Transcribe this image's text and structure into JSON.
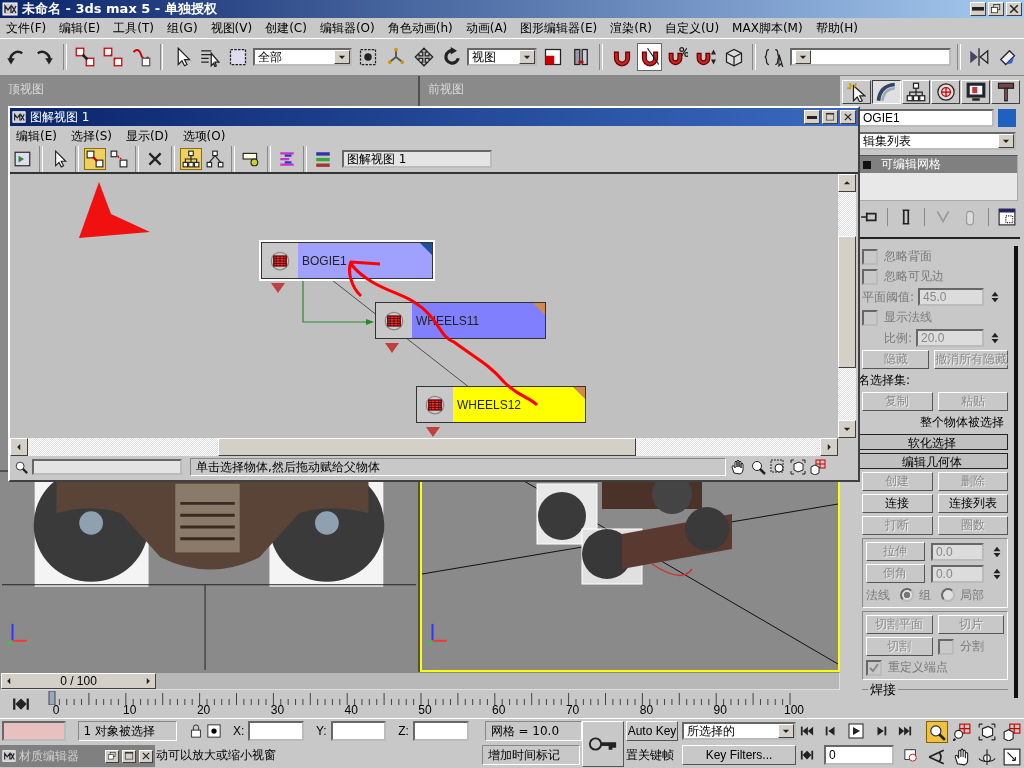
{
  "window": {
    "title": "未命名 - 3ds max 5 - 单独授权"
  },
  "menu": [
    "文件(F)",
    "编辑(E)",
    "工具(T)",
    "组(G)",
    "视图(V)",
    "创建(C)",
    "编辑器(O)",
    "角色动画(h)",
    "动画(A)",
    "图形编辑器(E)",
    "渲染(R)",
    "自定义(U)",
    "MAX脚本(M)",
    "帮助(H)"
  ],
  "toolbar": {
    "selection_filter": "全部",
    "coordinate_system": "视图",
    "buttons": [
      {
        "kind": "undo",
        "on": false
      },
      {
        "kind": "redo",
        "on": false
      },
      {
        "kind": "link",
        "on": false
      },
      {
        "kind": "unlink",
        "on": false
      },
      {
        "kind": "bind",
        "on": false
      },
      {
        "kind": "pointer",
        "on": false
      },
      {
        "kind": "select-name",
        "on": false
      },
      {
        "kind": "region",
        "on": false
      },
      {
        "kind": "crossing",
        "on": false
      },
      {
        "kind": "manipulate",
        "on": false
      },
      {
        "kind": "move",
        "on": false
      },
      {
        "kind": "rotate",
        "on": false
      },
      {
        "kind": "scale",
        "on": false
      },
      {
        "kind": "pivot",
        "on": false
      },
      {
        "kind": "snap",
        "on": false
      },
      {
        "kind": "angle-snap",
        "on": true
      },
      {
        "kind": "percent-snap",
        "on": false
      },
      {
        "kind": "spinner-snap",
        "on": false
      },
      {
        "kind": "sets",
        "on": false
      },
      {
        "kind": "named-sets",
        "on": false
      },
      {
        "kind": "mirror",
        "on": false
      },
      {
        "kind": "align",
        "on": false
      }
    ]
  },
  "viewports": [
    {
      "label": "顶视图",
      "active": false
    },
    {
      "label": "前视图",
      "active": false
    },
    {
      "active": false
    },
    {
      "active": true
    }
  ],
  "schematic": {
    "title": "图解视图 1",
    "menu": [
      "编辑(E)",
      "选择(S)",
      "显示(D)",
      "选项(O)"
    ],
    "toolbar": [
      {
        "kind": "floater",
        "selected": false
      },
      {
        "kind": "pointer",
        "selected": false
      },
      {
        "kind": "connect",
        "selected": true
      },
      {
        "kind": "disconnect",
        "selected": false
      },
      {
        "kind": "delete",
        "selected": false
      },
      {
        "kind": "hierarchy",
        "selected": true
      },
      {
        "kind": "references",
        "selected": false
      },
      {
        "kind": "filter",
        "selected": false
      },
      {
        "kind": "arrange",
        "selected": false
      },
      {
        "kind": "list",
        "selected": false
      }
    ],
    "view_name": "图解视图 1",
    "nodes": [
      {
        "name": "BOGIE1",
        "color": "#a0a0ff",
        "selected": true
      },
      {
        "name": "WHEELS11",
        "color": "#8080ff",
        "selected": false
      },
      {
        "name": "WHEELS12",
        "color": "#ffff00",
        "selected": false
      }
    ],
    "prompt": "单击选择物体,然后拖动赋给父物体"
  },
  "command_panel": {
    "tabs": [
      {
        "kind": "create",
        "selected": false
      },
      {
        "kind": "modify",
        "selected": true
      },
      {
        "kind": "hierarchy",
        "selected": false
      },
      {
        "kind": "motion",
        "selected": false
      },
      {
        "kind": "display",
        "selected": false
      },
      {
        "kind": "utilities",
        "selected": false
      }
    ],
    "object_name": "OGIE1",
    "modifier_list": "辑集列表",
    "stack": [
      {
        "name": "可编辑网格",
        "selected": true
      }
    ],
    "selection": {
      "checks": [
        {
          "label": "忽略背面",
          "checked": false
        },
        {
          "label": "忽略可见边",
          "checked": false
        }
      ],
      "threshold": {
        "label": "平面阈值:",
        "value": "45.0"
      },
      "normals": {
        "label": "显示法线",
        "checked": false
      },
      "scale": {
        "label": "比例:",
        "value": "20.0"
      },
      "buttons": [
        {
          "label": "隐藏",
          "disabled": true
        },
        {
          "label": "撤消所有隐藏",
          "disabled": true
        }
      ],
      "named_sets": "名选择集:",
      "set_buttons": [
        {
          "label": "复制",
          "disabled": true
        },
        {
          "label": "粘贴",
          "disabled": true
        }
      ],
      "info": "整个物体被选择"
    },
    "rollouts": [
      {
        "title": "软化选择"
      },
      {
        "title": "编辑几何体"
      }
    ],
    "geometry": {
      "buttons": [
        {
          "label": "创建",
          "disabled": true
        },
        {
          "label": "删除",
          "disabled": true
        },
        {
          "label": "连接",
          "disabled": false
        },
        {
          "label": "连接列表",
          "disabled": false
        },
        {
          "label": "打断",
          "disabled": true
        },
        {
          "label": "圈数",
          "disabled": true
        }
      ],
      "spinners": [
        {
          "label": "拉伸",
          "disabled": true,
          "value": "0.0"
        },
        {
          "label": "倒角",
          "disabled": true,
          "value": "0.0"
        }
      ],
      "normals_label": "法线",
      "normal_options": [
        {
          "label": "组",
          "selected": true
        },
        {
          "label": "局部",
          "selected": false
        }
      ],
      "cut_buttons": [
        {
          "label": "切割平面",
          "disabled": true
        },
        {
          "label": "切片",
          "disabled": true
        },
        {
          "label": "切割",
          "disabled": true
        }
      ],
      "split": {
        "label": "分割",
        "checked": false
      },
      "refine": {
        "label": "重定义端点",
        "checked": true
      },
      "weld": "焊接"
    }
  },
  "timeline": {
    "position": "0 / 100",
    "ticks": [
      "0",
      "10",
      "20",
      "30",
      "40",
      "50",
      "60",
      "70",
      "80",
      "90",
      "100"
    ]
  },
  "status": {
    "selection": "1 对象被选择",
    "x": "X:",
    "y": "Y:",
    "z": "Z:",
    "grid": "网格 = 10.0",
    "prompt": "动可以放大或缩小视窗",
    "time_tag": "增加时间标记",
    "auto_key": "Auto Key",
    "set_key": "置关键帧",
    "key_mode": "所选择的",
    "key_filters": "Key Filters...",
    "frame": "0",
    "nav": [
      {
        "kind": "zoom",
        "on": true
      },
      {
        "kind": "zoom-all",
        "on": false
      },
      {
        "kind": "extents",
        "on": false
      },
      {
        "kind": "extents-all",
        "on": false
      },
      {
        "kind": "fov",
        "on": false
      },
      {
        "kind": "pan",
        "on": false
      },
      {
        "kind": "orbit",
        "on": false
      },
      {
        "kind": "maximize",
        "on": false
      }
    ]
  },
  "mini_window": {
    "title": "材质编辑器"
  }
}
